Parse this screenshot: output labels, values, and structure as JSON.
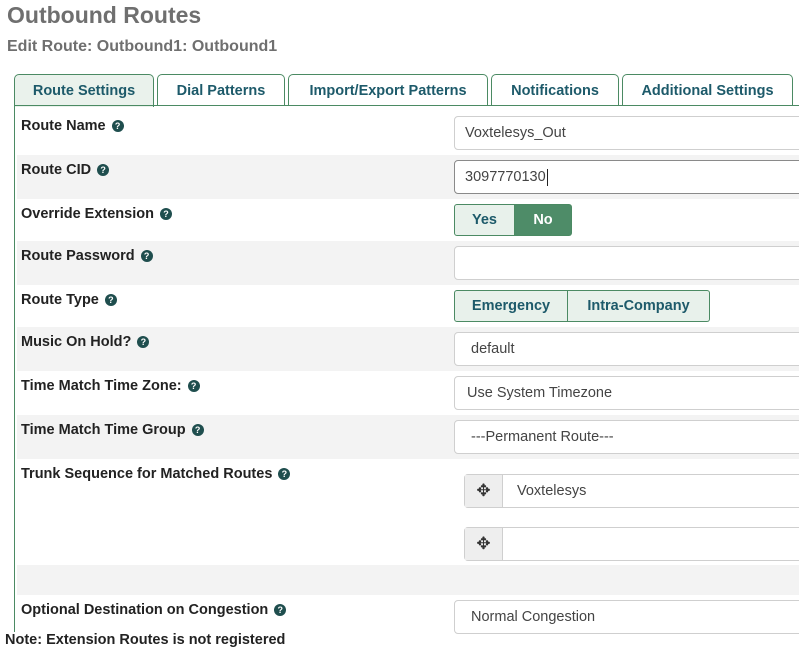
{
  "page": {
    "title": "Outbound Routes",
    "subtitle": "Edit Route: Outbound1: Outbound1"
  },
  "tabs": [
    {
      "label": "Route Settings",
      "active": true
    },
    {
      "label": "Dial Patterns",
      "active": false
    },
    {
      "label": "Import/Export Patterns",
      "active": false
    },
    {
      "label": "Notifications",
      "active": false
    },
    {
      "label": "Additional Settings",
      "active": false
    }
  ],
  "form": {
    "route_name": {
      "label": "Route Name",
      "value": "Voxtelesys_Out"
    },
    "route_cid": {
      "label": "Route CID",
      "value": "3097770130"
    },
    "override_extension": {
      "label": "Override Extension",
      "options": [
        "Yes",
        "No"
      ],
      "selected": "No"
    },
    "route_password": {
      "label": "Route Password",
      "value": ""
    },
    "route_type": {
      "label": "Route Type",
      "options": [
        "Emergency",
        "Intra-Company"
      ]
    },
    "music_on_hold": {
      "label": "Music On Hold?",
      "value": "default"
    },
    "time_zone": {
      "label": "Time Match Time Zone:",
      "value": "Use System Timezone"
    },
    "time_group": {
      "label": "Time Match Time Group",
      "value": "---Permanent Route---"
    },
    "trunk_sequence": {
      "label": "Trunk Sequence for Matched Routes",
      "trunks": [
        "Voxtelesys",
        ""
      ]
    },
    "congestion": {
      "label": "Optional Destination on Congestion",
      "value": "Normal Congestion"
    }
  },
  "note": "Note: Extension Routes is not registered",
  "icons": {
    "help": "question-circle-icon",
    "drag": "arrows-move-icon"
  },
  "colors": {
    "accent": "#4e8c68",
    "tab_text": "#1d5a6a",
    "title": "#6f6f6f"
  }
}
